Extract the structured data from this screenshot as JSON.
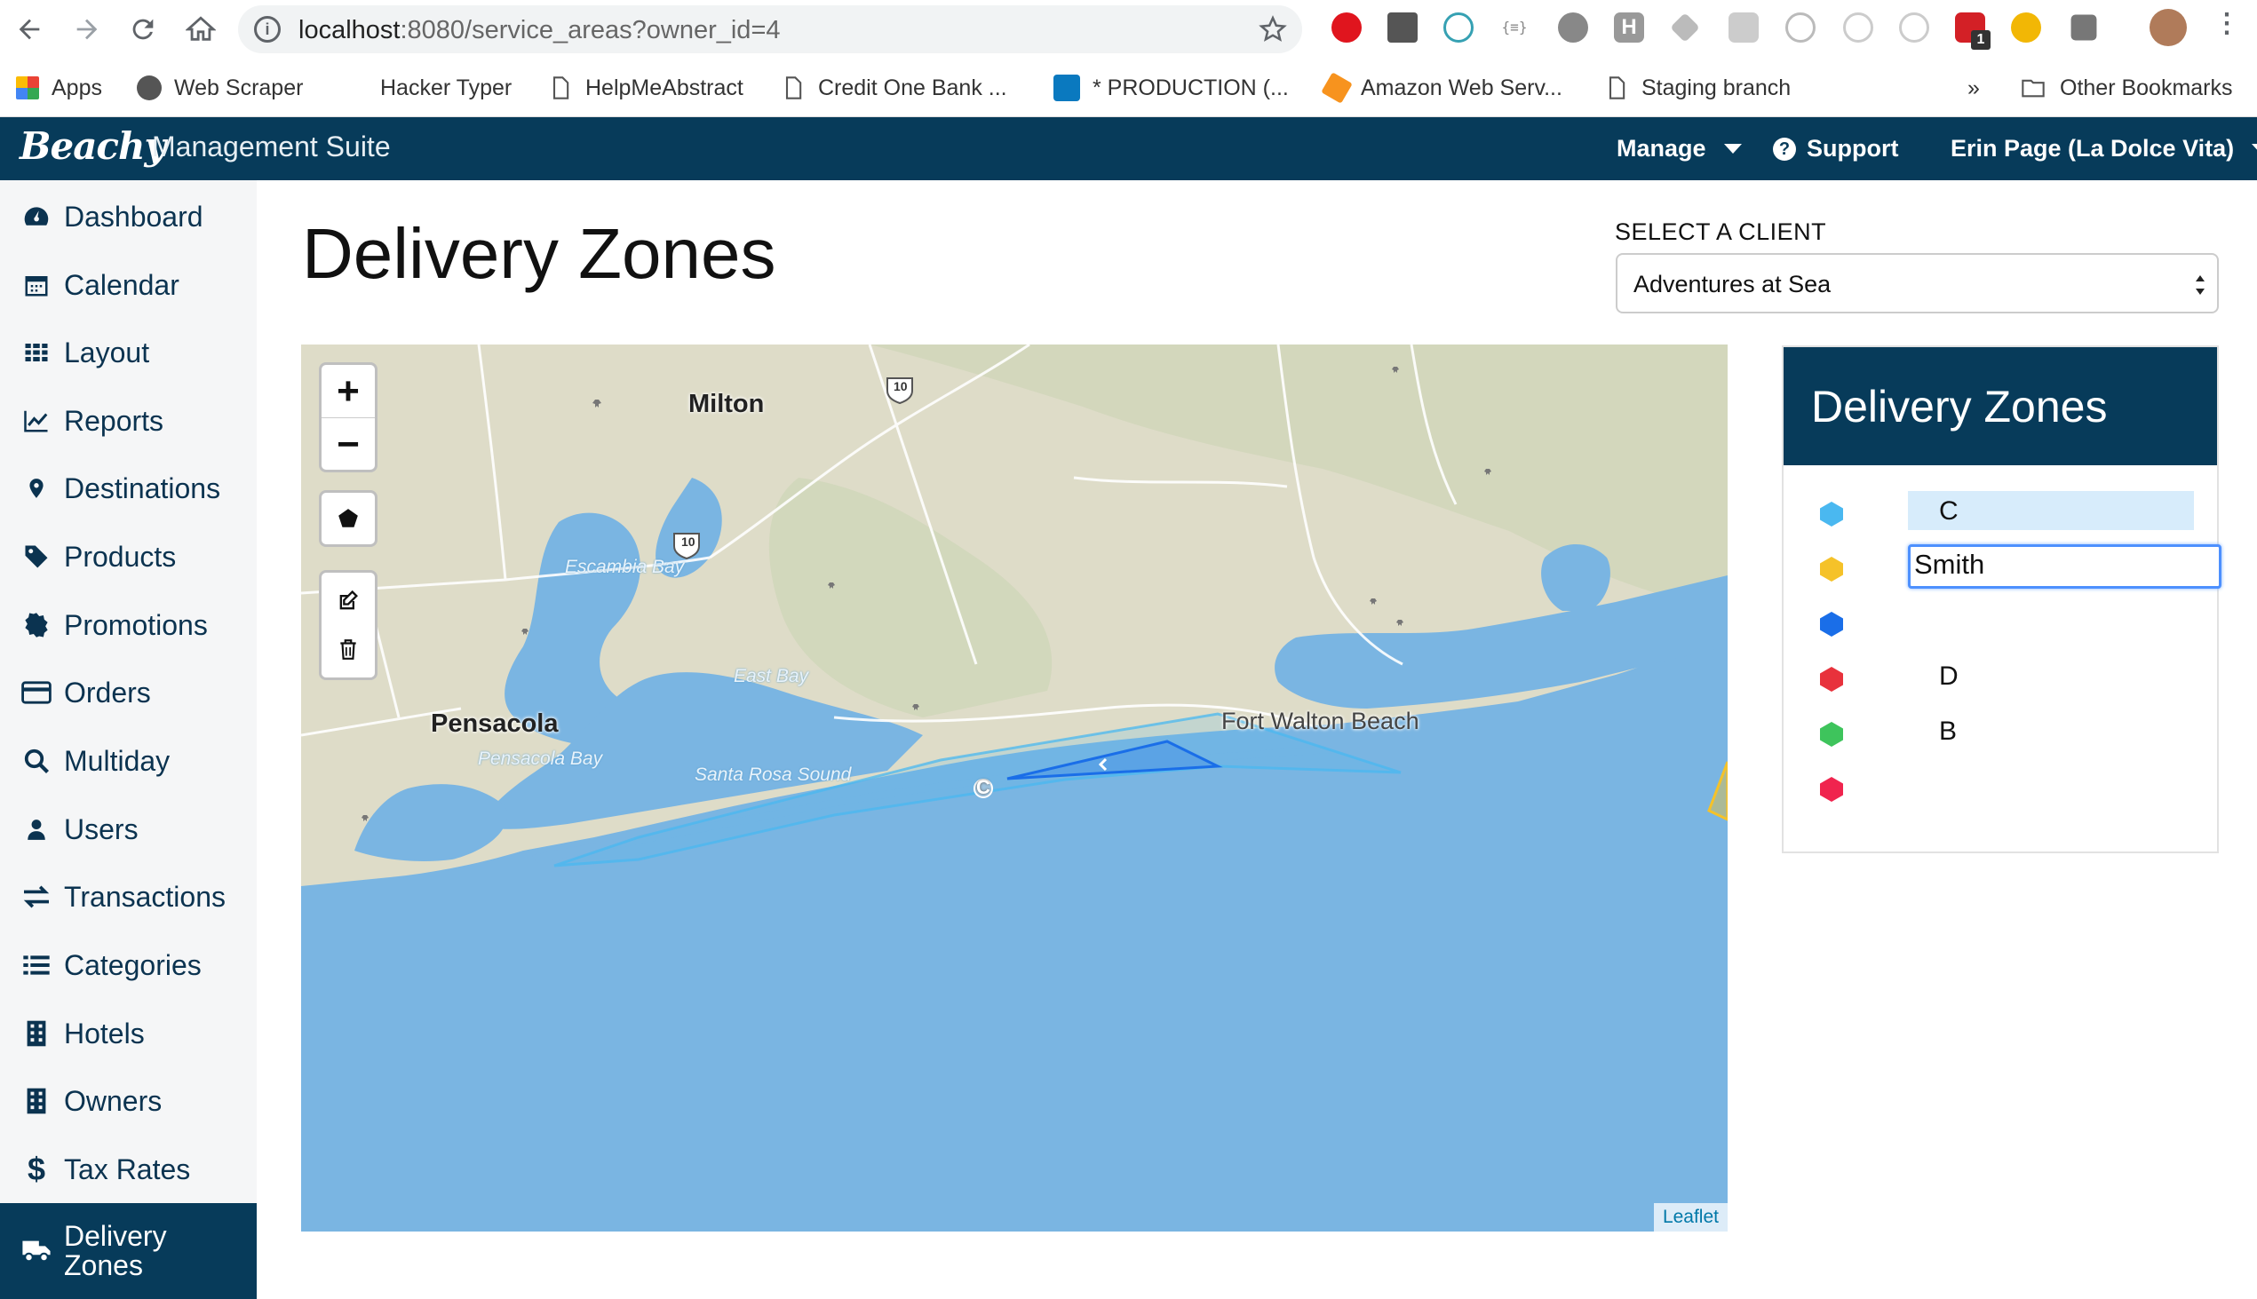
{
  "browser": {
    "url_host": "localhost",
    "url_path": ":8080/service_areas?owner_id=4",
    "extension_badge": "1",
    "bookmarks": [
      {
        "label": "Apps",
        "icon": "apps-grid-icon"
      },
      {
        "label": "Web Scraper",
        "icon": "web-scraper-icon"
      },
      {
        "label": "Hacker Typer",
        "icon": ""
      },
      {
        "label": "HelpMeAbstract",
        "icon": "page-icon"
      },
      {
        "label": "Credit One Bank ...",
        "icon": "page-icon"
      },
      {
        "label": "* PRODUCTION (...",
        "icon": "trello-icon"
      },
      {
        "label": "Amazon Web Serv...",
        "icon": "aws-icon"
      },
      {
        "label": "Staging branch",
        "icon": "page-icon"
      }
    ],
    "more_bookmarks": "»",
    "other_bookmarks": "Other Bookmarks"
  },
  "header": {
    "brand": "Beachy",
    "suite": "Management Suite",
    "manage": "Manage",
    "support": "Support",
    "user": "Erin Page (La Dolce Vita)"
  },
  "sidebar": {
    "items": [
      {
        "label": "Dashboard",
        "icon": "dashboard-icon"
      },
      {
        "label": "Calendar",
        "icon": "calendar-icon"
      },
      {
        "label": "Layout",
        "icon": "grid-icon"
      },
      {
        "label": "Reports",
        "icon": "chart-icon"
      },
      {
        "label": "Destinations",
        "icon": "map-marker-icon"
      },
      {
        "label": "Products",
        "icon": "tag-icon"
      },
      {
        "label": "Promotions",
        "icon": "badge-icon"
      },
      {
        "label": "Orders",
        "icon": "credit-card-icon"
      },
      {
        "label": "Multiday",
        "icon": "search-icon"
      },
      {
        "label": "Users",
        "icon": "user-icon"
      },
      {
        "label": "Transactions",
        "icon": "exchange-icon"
      },
      {
        "label": "Categories",
        "icon": "list-icon"
      },
      {
        "label": "Hotels",
        "icon": "building-icon"
      },
      {
        "label": "Owners",
        "icon": "building-icon"
      },
      {
        "label": "Tax Rates",
        "icon": "dollar-icon"
      },
      {
        "label": "Delivery Zones",
        "icon": "truck-icon"
      }
    ],
    "active": "Delivery Zones"
  },
  "main": {
    "title": "Delivery Zones",
    "client_label": "SELECT A CLIENT",
    "client_value": "Adventures at Sea"
  },
  "map": {
    "zoom_in": "+",
    "zoom_out": "−",
    "attribution": "Leaflet",
    "labels": {
      "milton": "Milton",
      "pensacola": "Pensacola",
      "escambia_bay": "Escambia Bay",
      "east_bay": "East Bay",
      "pensacola_bay": "Pensacola Bay",
      "santa_rosa_sound": "Santa Rosa Sound",
      "fort_walton_beach": "Fort Walton Beach",
      "highway": "10",
      "zone_marker": "C"
    }
  },
  "zones": {
    "title": "Delivery Zones",
    "rows": [
      {
        "name": "C",
        "color": "#4ab8f0",
        "state": "highlighted"
      },
      {
        "name": "Smith",
        "color": "#f5c229",
        "state": "editing"
      },
      {
        "name": "",
        "color": "#1a6ee8",
        "state": "normal"
      },
      {
        "name": "D",
        "color": "#e8323c",
        "state": "normal"
      },
      {
        "name": "B",
        "color": "#3ec45c",
        "state": "normal"
      },
      {
        "name": "",
        "color": "#f0244e",
        "state": "normal"
      }
    ]
  },
  "colors": {
    "navy": "#073b5a",
    "water": "#7ab5e2",
    "land": "#dedcc8"
  }
}
